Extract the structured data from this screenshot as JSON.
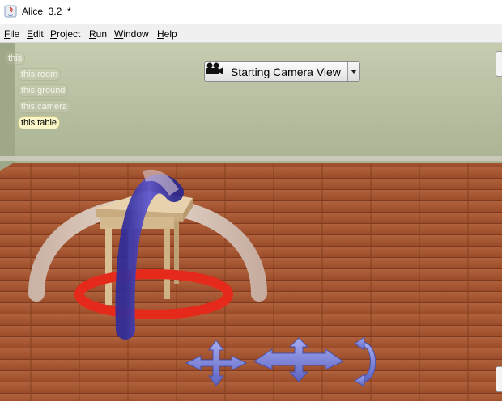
{
  "window": {
    "title": "Alice  3.2  *"
  },
  "menu": {
    "items": [
      "File",
      "Edit",
      "Project",
      "Run",
      "Window",
      "Help"
    ]
  },
  "scene_tree": {
    "root": "this",
    "children": [
      "this.room",
      "this.ground",
      "this.camera",
      "this.table"
    ],
    "selected": "this.table"
  },
  "camera_view": {
    "label": "Starting Camera View"
  },
  "handles": [
    "translate-horizontal-handle",
    "translate-vertical-handle",
    "rotate-handle"
  ],
  "colors": {
    "wall": "#b9c1a3",
    "floor": "#a7532f",
    "ring_red": "#e52a1b",
    "arch_blue": "#3f3bb0",
    "arch_beige": "#d5c1b4",
    "handle_blue": "#7b82d8"
  }
}
